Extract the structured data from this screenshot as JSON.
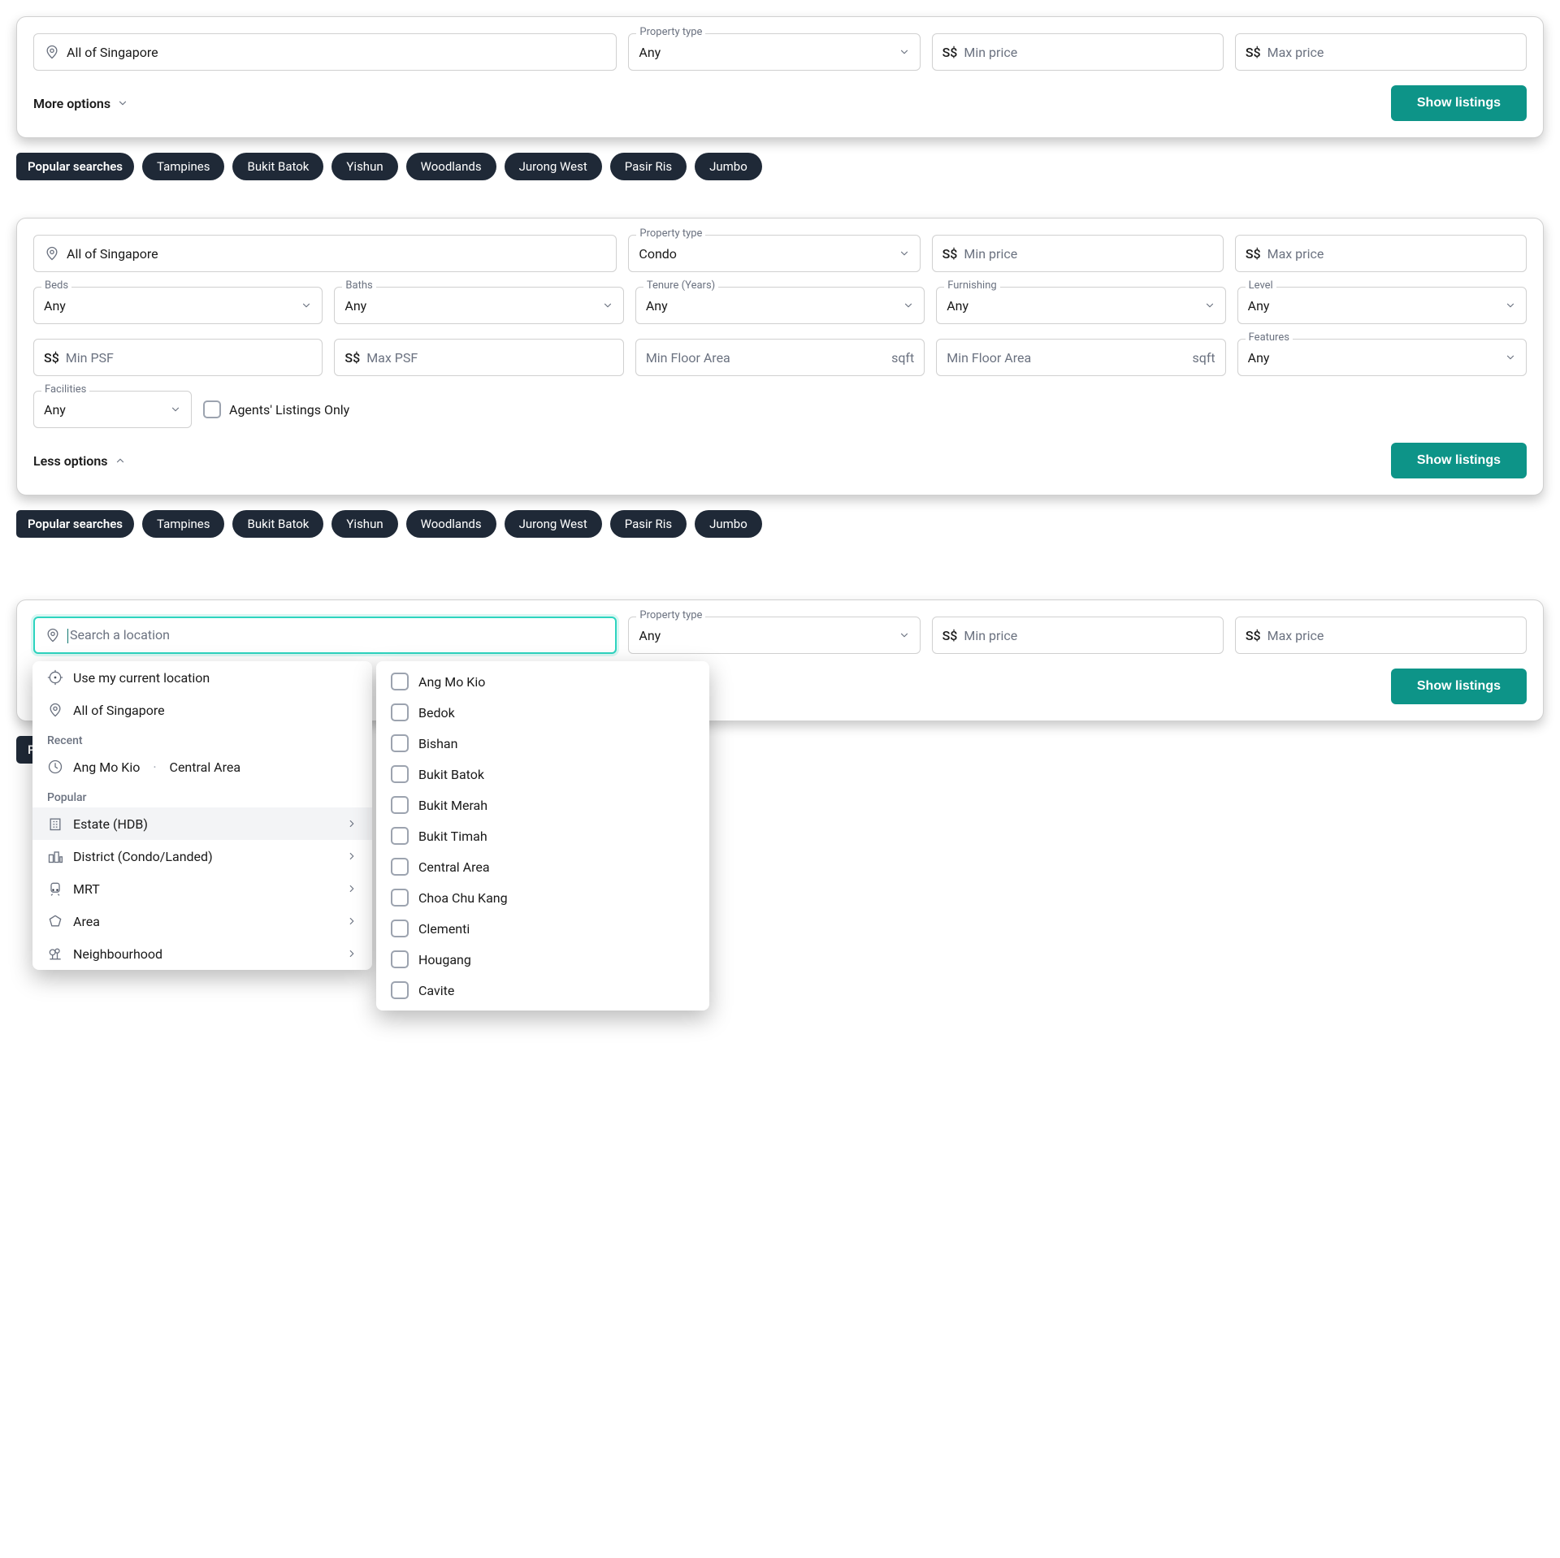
{
  "currency_prefix": "S$",
  "area_suffix": "sqft",
  "popular_searches_label": "Popular searches",
  "popular_searches": [
    "Tampines",
    "Bukit Batok",
    "Yishun",
    "Woodlands",
    "Jurong West",
    "Pasir Ris",
    "Jumbo"
  ],
  "panel1": {
    "location_value": "All of Singapore",
    "property_type_label": "Property type",
    "property_type_value": "Any",
    "min_price_placeholder": "Min price",
    "max_price_placeholder": "Max price",
    "toggle_label": "More options",
    "cta": "Show listings"
  },
  "panel2": {
    "location_value": "All of Singapore",
    "property_type_label": "Property type",
    "property_type_value": "Condo",
    "min_price_placeholder": "Min price",
    "max_price_placeholder": "Max price",
    "beds": {
      "label": "Beds",
      "value": "Any"
    },
    "baths": {
      "label": "Baths",
      "value": "Any"
    },
    "tenure": {
      "label": "Tenure (Years)",
      "value": "Any"
    },
    "furnishing": {
      "label": "Furnishing",
      "value": "Any"
    },
    "level": {
      "label": "Level",
      "value": "Any"
    },
    "min_psf_placeholder": "Min PSF",
    "max_psf_placeholder": "Max PSF",
    "min_floor_placeholder": "Min Floor Area",
    "max_floor_placeholder": "Min Floor Area",
    "features": {
      "label": "Features",
      "value": "Any"
    },
    "facilities": {
      "label": "Facilities",
      "value": "Any"
    },
    "agents_only_label": "Agents' Listings Only",
    "toggle_label": "Less options",
    "cta": "Show listings"
  },
  "panel3": {
    "location_placeholder": "Search a location",
    "property_type_label": "Property type",
    "property_type_value": "Any",
    "min_price_placeholder": "Min price",
    "max_price_placeholder": "Max price",
    "cta": "Show listings",
    "loc_dropdown": {
      "use_current": "Use my current location",
      "all_sg": "All of Singapore",
      "recent_label": "Recent",
      "recent_text_a": "Ang Mo Kio",
      "recent_text_b": "Central Area",
      "popular_label": "Popular",
      "categories": [
        "Estate (HDB)",
        "District (Condo/Landed)",
        "MRT",
        "Area",
        "Neighbourhood"
      ]
    },
    "estates": [
      "Ang Mo Kio",
      "Bedok",
      "Bishan",
      "Bukit Batok",
      "Bukit Merah",
      "Bukit Timah",
      "Central Area",
      "Choa Chu Kang",
      "Clementi",
      "Hougang",
      "Cavite"
    ]
  },
  "popular_label_truncated": "Po"
}
